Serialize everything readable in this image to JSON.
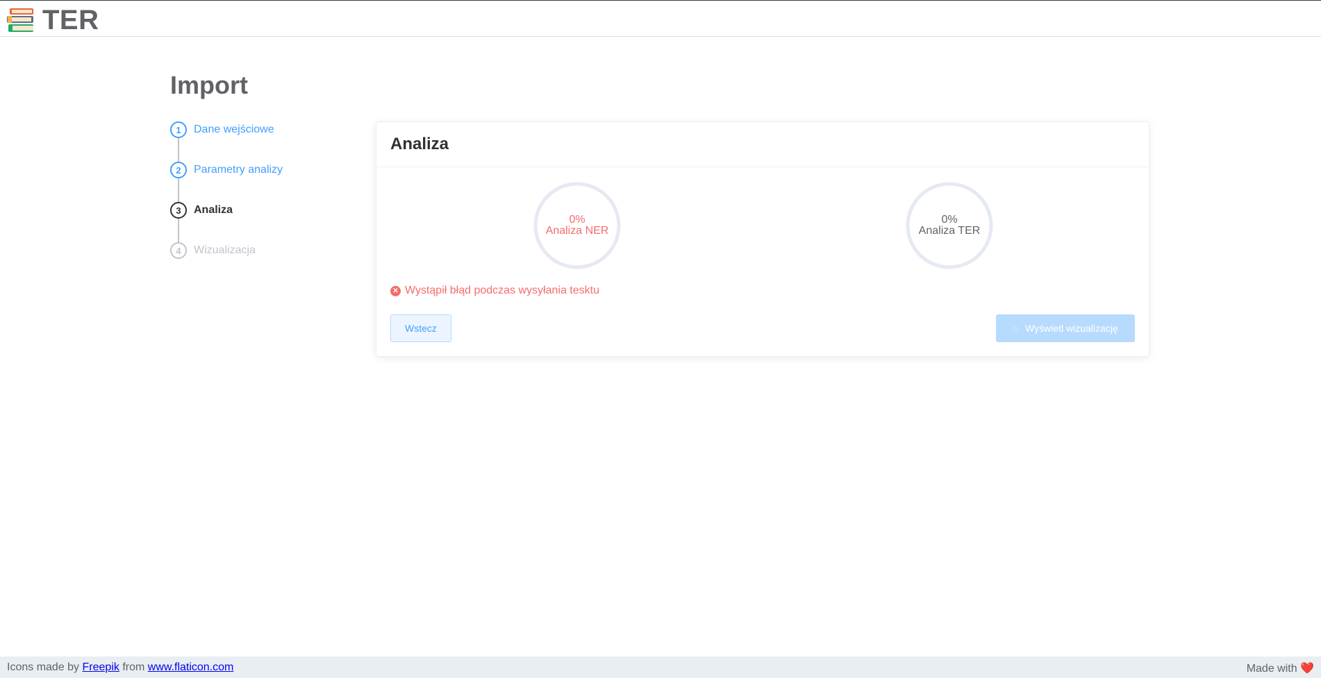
{
  "header": {
    "logo_icon": "books-icon",
    "title": "TER"
  },
  "page": {
    "title": "Import"
  },
  "steps": [
    {
      "number": "1",
      "label": "Dane wejściowe",
      "status": "done"
    },
    {
      "number": "2",
      "label": "Parametry analizy",
      "status": "done"
    },
    {
      "number": "3",
      "label": "Analiza",
      "status": "active"
    },
    {
      "number": "4",
      "label": "Wizualizacja",
      "status": "pending"
    }
  ],
  "card": {
    "title": "Analiza",
    "progress_ner": {
      "percent": "0%",
      "label": "Analiza NER",
      "value": 0,
      "status": "error"
    },
    "progress_ter": {
      "percent": "0%",
      "label": "Analiza TER",
      "value": 0,
      "status": "normal"
    },
    "error_message": "Wystąpił błąd podczas wysyłania tesktu",
    "back_button": "Wstecz",
    "show_button": "Wyświetl wizualizację"
  },
  "footer": {
    "prefix": "Icons made by",
    "author_link": "Freepik",
    "middle": "from",
    "site_link": "www.flaticon.com",
    "made_with": "Made with",
    "heart": "❤️"
  },
  "colors": {
    "primary": "#409eff",
    "error": "#f56c6c",
    "text_secondary": "#606266",
    "footer_bg": "#e9eef3"
  }
}
